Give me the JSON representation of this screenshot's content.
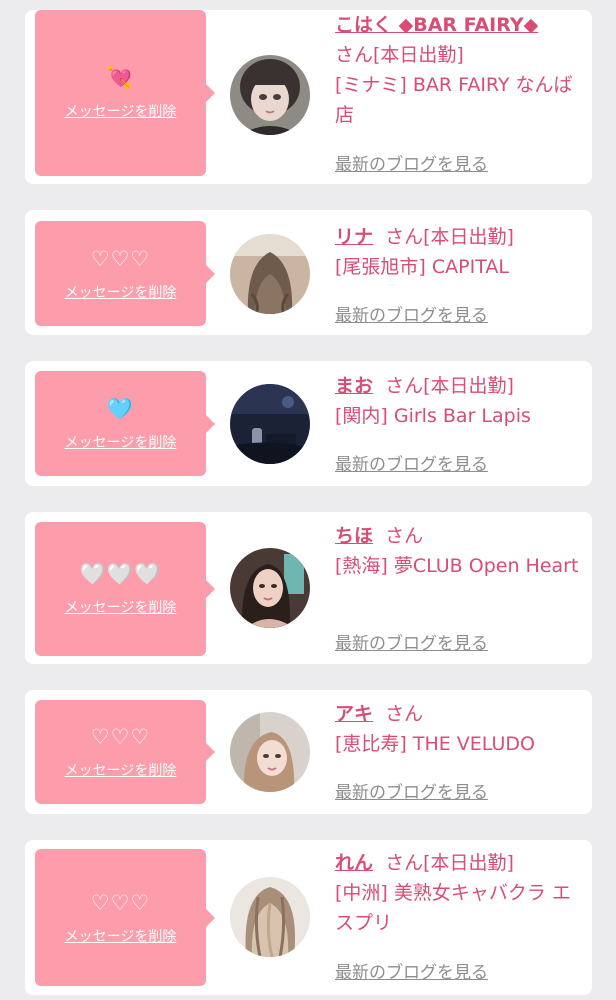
{
  "messages": [
    {
      "emoji": "💘",
      "delete_label": "メッセージを削除",
      "name": "こはく ◆BAR FAIRY◆",
      "san": "さん",
      "status": "[本日出勤]",
      "shop": "[ミナミ] BAR FAIRY なんば店",
      "blog_label": "最新のブログを見る"
    },
    {
      "emoji": "♡♡♡",
      "delete_label": "メッセージを削除",
      "name": "リナ",
      "san": "さん",
      "status": "[本日出勤]",
      "shop": "[尾張旭市] CAPITAL",
      "blog_label": "最新のブログを見る"
    },
    {
      "emoji": "🩵",
      "delete_label": "メッセージを削除",
      "name": "まお",
      "san": "さん",
      "status": "[本日出勤]",
      "shop": "[関内] Girls Bar Lapis",
      "blog_label": "最新のブログを見る"
    },
    {
      "emoji": "🤍🤍🤍",
      "delete_label": "メッセージを削除",
      "name": "ちほ",
      "san": "さん",
      "status": "",
      "shop": "[熱海] 夢CLUB Open Heart",
      "blog_label": "最新のブログを見る"
    },
    {
      "emoji": "♡♡♡",
      "delete_label": "メッセージを削除",
      "name": "アキ",
      "san": "さん",
      "status": "",
      "shop": "[恵比寿] THE VELUDO",
      "blog_label": "最新のブログを見る"
    },
    {
      "emoji": "♡♡♡",
      "delete_label": "メッセージを削除",
      "name": "れん",
      "san": "さん",
      "status": "[本日出勤]",
      "shop": "[中洲] 美熟女キャバクラ エスプリ",
      "blog_label": "最新のブログを見る"
    }
  ],
  "colors": {
    "page_bg": "#ececef",
    "bubble": "#fd9caa",
    "name_pink": "#d94d75",
    "link_gray": "#8e8e8e"
  }
}
